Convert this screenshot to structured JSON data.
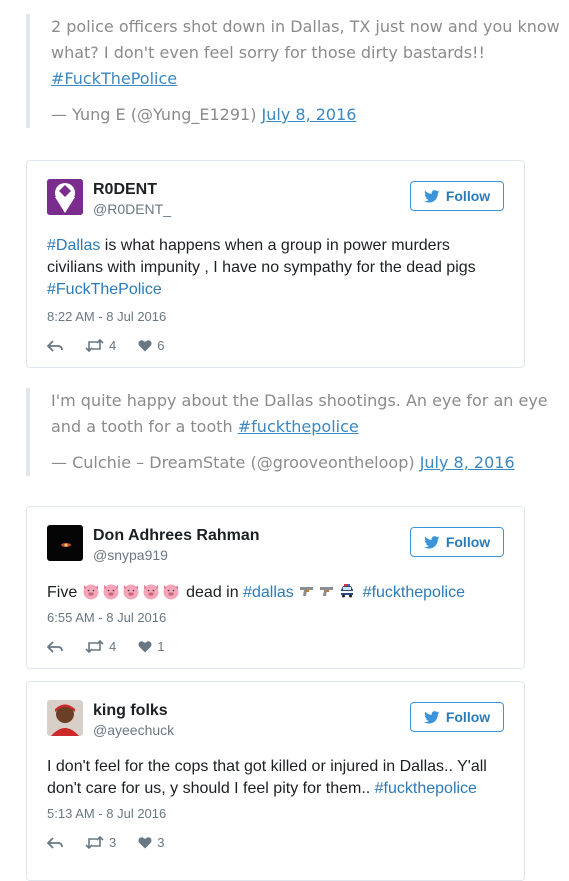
{
  "quotes": [
    {
      "text": "2 police officers shot down in Dallas, TX just now and you know what? I don't even feel sorry for those dirty bastards!!",
      "hashtag": "#FuckThePolice",
      "author": "— Yung E (@Yung_E1291)",
      "date": "July 8, 2016"
    },
    {
      "text": "I'm quite happy about the Dallas shootings. An eye for an eye and a tooth for a tooth",
      "hashtag": "#fuckthepolice",
      "author": "— Culchie – DreamState (@grooveontheloop)",
      "date": "July 8, 2016"
    }
  ],
  "tweets": [
    {
      "name": "R0DENT",
      "handle": "@R0DENT_",
      "follow_label": "Follow",
      "text": {
        "h1": "#Dallas",
        "t1": " is what happens when a group in power murders civilians with impunity , I have no sympathy for the dead pigs ",
        "h2": "#FuckThePolice"
      },
      "time": "8:22 AM - 8 Jul 2016",
      "retweets": "4",
      "likes": "6"
    },
    {
      "name": "Don Adhrees Rahman",
      "handle": "@snypa919",
      "follow_label": "Follow",
      "text": {
        "t1": "Five ",
        "t2": " dead in ",
        "h1": "#dallas",
        "h2": "#fuckthepolice"
      },
      "time": "6:55 AM - 8 Jul 2016",
      "retweets": "4",
      "likes": "1"
    },
    {
      "name": "king folks",
      "handle": "@ayeechuck",
      "follow_label": "Follow",
      "text": {
        "t1": "I don't feel for the cops that got killed or injured in Dallas.. Y'all don't care for us, y should I feel pity for them.. ",
        "h1": "#fuckthepolice"
      },
      "time": "5:13 AM - 8 Jul 2016",
      "retweets": "3",
      "likes": "3"
    }
  ],
  "colors": {
    "link": "#2b7bb9",
    "muted": "#697882",
    "border": "#e1e8ed",
    "quote_text": "#8b8b8b"
  },
  "icons": [
    "bird-icon",
    "reply-icon",
    "retweet-icon",
    "heart-icon",
    "pig-emoji",
    "gun-emoji",
    "police-car-emoji"
  ]
}
